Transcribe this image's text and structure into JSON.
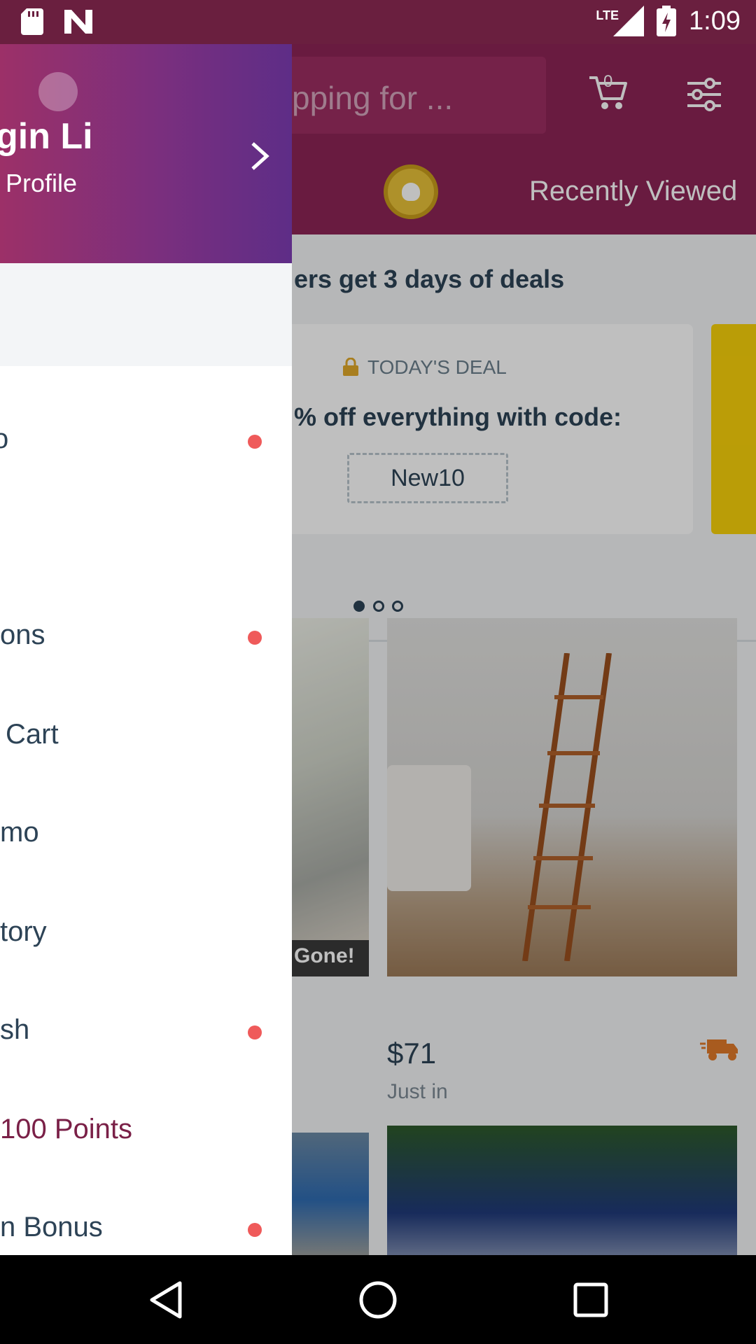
{
  "status_bar": {
    "time": "1:09",
    "network": "LTE"
  },
  "header": {
    "search_placeholder": "pping for ...",
    "cart_count": "0",
    "tab_recently_viewed": "Recently Viewed"
  },
  "deals": {
    "title": "ers get 3 days of deals",
    "label": "TODAY'S DEAL",
    "description": "% off everything with code:",
    "code": "New10"
  },
  "products": [
    {
      "badge": "Gone!"
    },
    {
      "price": "$71",
      "status": "Just in"
    }
  ],
  "drawer": {
    "user_name": "gin Li",
    "profile_link": "Profile",
    "menu_items": [
      {
        "label": "o",
        "dot": true
      },
      {
        "label": "ons",
        "dot": true
      },
      {
        "label": "Cart",
        "dot": false
      },
      {
        "label": "mo",
        "dot": false
      },
      {
        "label": "tory",
        "dot": false
      },
      {
        "label": "sh",
        "dot": true
      },
      {
        "label": "100 Points",
        "dot": false
      },
      {
        "label": "n Bonus",
        "dot": true
      }
    ]
  },
  "colors": {
    "brand": "#8c2456",
    "status_bar": "#6a1f3f",
    "text_dark": "#2d4356",
    "notification_dot": "#ef5a5a",
    "points_accent": "#7a2047"
  }
}
